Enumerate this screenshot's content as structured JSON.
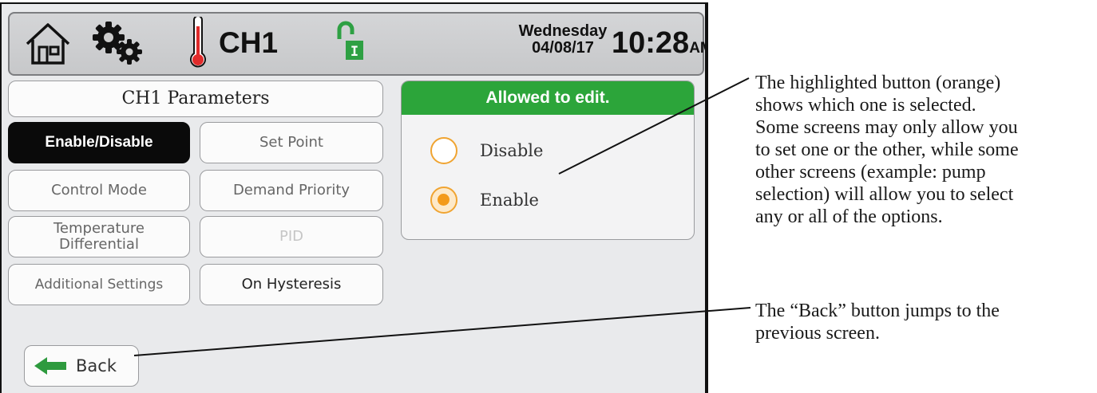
{
  "status_bar": {
    "channel": "CH1",
    "day": "Wednesday",
    "date": "04/08/17",
    "time": "10:28",
    "ampm": "AM",
    "icons": [
      "home-icon",
      "gear-icon",
      "thermometer-icon",
      "unlocked-icon"
    ],
    "lock_badge": "I"
  },
  "panel": {
    "title": "CH1 Parameters",
    "buttons": {
      "enable_disable": "Enable/Disable",
      "set_point": "Set Point",
      "control_mode": "Control Mode",
      "demand_priority": "Demand Priority",
      "temp_diff_1": "Temperature",
      "temp_diff_2": "Differential",
      "pid": "PID",
      "additional_settings": "Additional Settings",
      "on_hysteresis": "On Hysteresis"
    },
    "selected": "Enable/Disable"
  },
  "edit_box": {
    "header": "Allowed to edit.",
    "options": [
      {
        "label": "Disable",
        "selected": false
      },
      {
        "label": "Enable",
        "selected": true
      }
    ]
  },
  "back": {
    "label": "Back"
  },
  "annotations": {
    "radio_note": [
      "The highlighted button (orange)",
      "shows which one is selected.",
      "Some screens may only allow you",
      "to set one or the other, while some",
      "other screens (example: pump",
      "selection) will allow you to select",
      "any or all of the options."
    ],
    "back_note": [
      "The “Back” button jumps to the",
      "previous screen."
    ]
  },
  "colors": {
    "header_green": "#2ca53a",
    "radio_orange": "#f39a1a",
    "selected_button": "#0a0a0a",
    "thermometer_red": "#e02b2b",
    "lock_green": "#2ea043",
    "back_arrow_green": "#2e9a3e"
  }
}
